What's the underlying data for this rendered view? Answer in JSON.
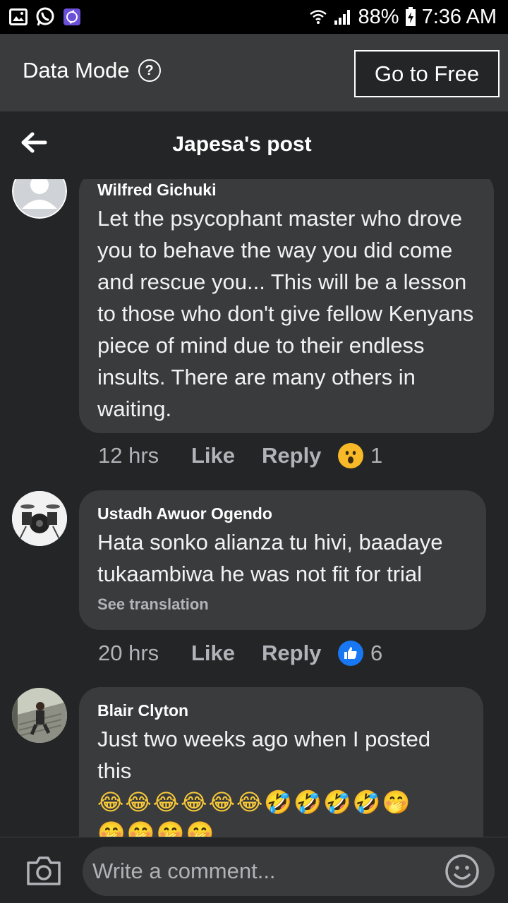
{
  "status_bar": {
    "battery": "88%",
    "time": "7:36 AM"
  },
  "data_mode": {
    "label": "Data Mode",
    "help": "?",
    "go_to_free": "Go to Free"
  },
  "header": {
    "title": "Japesa's post"
  },
  "comments": [
    {
      "author": "Wilfred Gichuki",
      "text": "Let the psycophant  master who drove you to behave the way you did come and rescue you... This will be a lesson to those who don't give fellow Kenyans piece of mind due to their endless insults. There are many others in waiting.",
      "time": "12 hrs",
      "like": "Like",
      "reply": "Reply",
      "reaction_icon": "wow-reaction-icon",
      "reaction_count": "1"
    },
    {
      "author": "Ustadh Awuor Ogendo",
      "text": "Hata sonko alianza tu hivi, baadaye tukaambiwa he was not fit for trial",
      "see_translation": "See translation",
      "time": "20 hrs",
      "like": "Like",
      "reply": "Reply",
      "reaction_icon": "like-reaction-icon",
      "reaction_count": "6"
    },
    {
      "author": "Blair Clyton",
      "text": "Just two weeks ago when I posted this",
      "emojis_line1": "😂😂😂😂😂😂🤣🤣🤣🤣🤭",
      "emojis_line2": "🤭🤭🤭🤭"
    }
  ],
  "composer": {
    "placeholder": "Write a comment..."
  },
  "colors": {
    "background": "#242526",
    "bubble": "#3a3b3c",
    "like_blue": "#1877f2",
    "wow_yellow": "#f7b928"
  }
}
